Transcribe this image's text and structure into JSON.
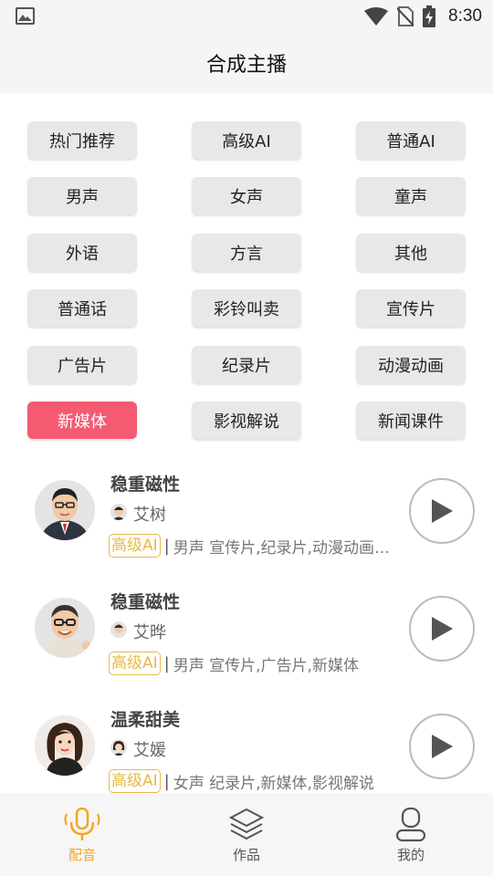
{
  "status_bar": {
    "time": "8:30"
  },
  "header": {
    "title": "合成主播"
  },
  "categories": [
    {
      "label": "热门推荐",
      "active": false
    },
    {
      "label": "高级AI",
      "active": false
    },
    {
      "label": "普通AI",
      "active": false
    },
    {
      "label": "男声",
      "active": false
    },
    {
      "label": "女声",
      "active": false
    },
    {
      "label": "童声",
      "active": false
    },
    {
      "label": "外语",
      "active": false
    },
    {
      "label": "方言",
      "active": false
    },
    {
      "label": "其他",
      "active": false
    },
    {
      "label": "普通话",
      "active": false
    },
    {
      "label": "彩铃叫卖",
      "active": false
    },
    {
      "label": "宣传片",
      "active": false
    },
    {
      "label": "广告片",
      "active": false
    },
    {
      "label": "纪录片",
      "active": false
    },
    {
      "label": "动漫动画",
      "active": false
    },
    {
      "label": "新媒体",
      "active": true
    },
    {
      "label": "影视解说",
      "active": false
    },
    {
      "label": "新闻课件",
      "active": false
    }
  ],
  "colors": {
    "active_category": "#f45b72",
    "level_tag": "#e6b94a",
    "nav_active": "#f5a623"
  },
  "anchors": [
    {
      "title": "稳重磁性",
      "name": "艾树",
      "level": "高级AI",
      "separator": "|",
      "description": "男声 宣传片,纪录片,动漫动画…"
    },
    {
      "title": "稳重磁性",
      "name": "艾晔",
      "level": "高级AI",
      "separator": "|",
      "description": "男声 宣传片,广告片,新媒体"
    },
    {
      "title": "温柔甜美",
      "name": "艾媛",
      "level": "高级AI",
      "separator": "|",
      "description": "女声 纪录片,新媒体,影视解说"
    }
  ],
  "bottom_nav": [
    {
      "label": "配音",
      "icon": "microphone-icon",
      "active": true
    },
    {
      "label": "作品",
      "icon": "layers-icon",
      "active": false
    },
    {
      "label": "我的",
      "icon": "user-icon",
      "active": false
    }
  ]
}
